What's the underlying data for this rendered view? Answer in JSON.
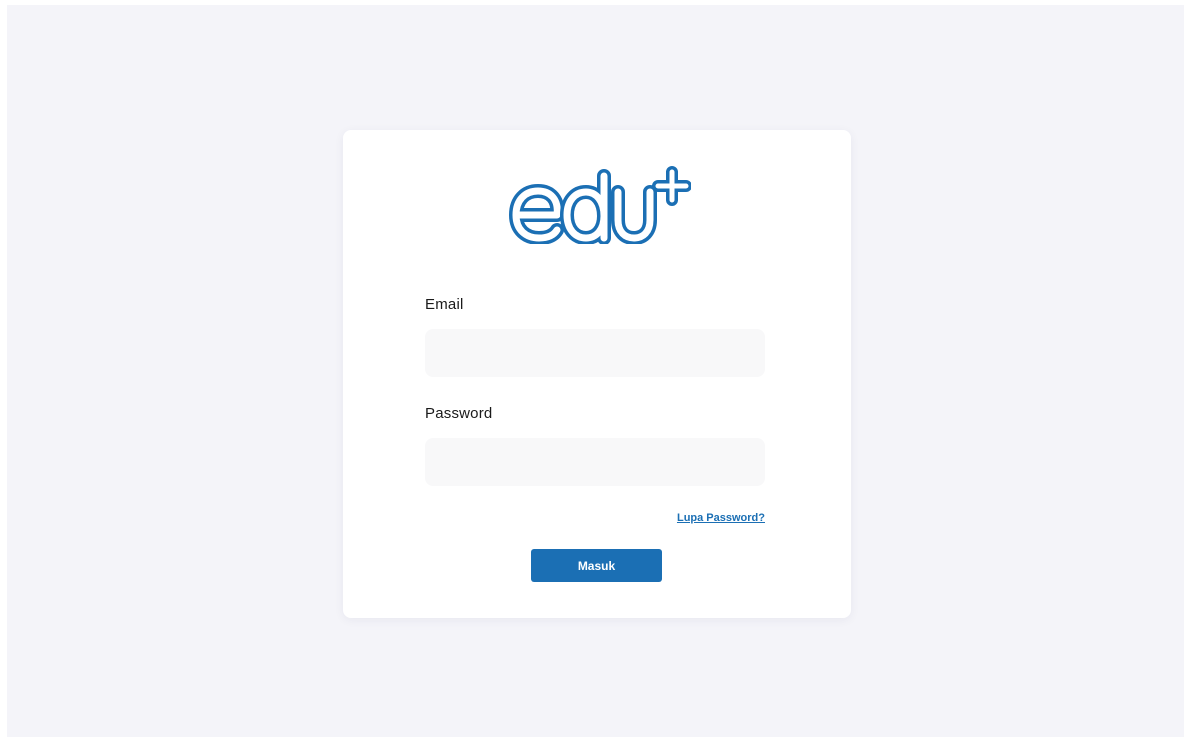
{
  "brand": {
    "logo_text": "edu+",
    "color": "#1b6fb4"
  },
  "form": {
    "email_label": "Email",
    "email_value": "",
    "email_placeholder": "",
    "password_label": "Password",
    "password_value": "",
    "password_placeholder": "",
    "forgot_label": "Lupa Password?",
    "submit_label": "Masuk"
  },
  "colors": {
    "page_background": "#f4f4f9",
    "card_background": "#ffffff",
    "input_background": "#f8f8f9",
    "accent": "#1b6fb4"
  }
}
